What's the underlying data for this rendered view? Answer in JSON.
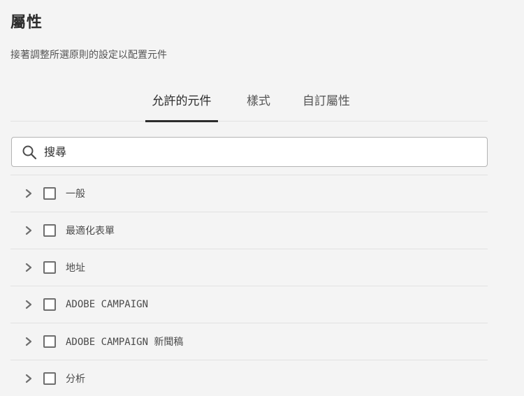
{
  "panel": {
    "title": "屬性",
    "subtitle": "接著調整所選原則的設定以配置元件"
  },
  "tabs": [
    {
      "label": "允許的元件",
      "active": true
    },
    {
      "label": "樣式",
      "active": false
    },
    {
      "label": "自訂屬性",
      "active": false
    }
  ],
  "search": {
    "placeholder": "搜尋",
    "value": "",
    "icon": "search-icon"
  },
  "components": [
    {
      "label": "一般",
      "checked": false,
      "expanded": false
    },
    {
      "label": "最適化表單",
      "checked": false,
      "expanded": false
    },
    {
      "label": "地址",
      "checked": false,
      "expanded": false
    },
    {
      "label": "ADOBE CAMPAIGN",
      "checked": false,
      "expanded": false
    },
    {
      "label": "ADOBE CAMPAIGN 新聞稿",
      "checked": false,
      "expanded": false
    },
    {
      "label": "分析",
      "checked": false,
      "expanded": false
    }
  ],
  "colors": {
    "background": "#f4f4f4",
    "text": "#2c2c2c",
    "border": "#e1e1e1",
    "active_tab_indicator": "#2c2c2c"
  }
}
